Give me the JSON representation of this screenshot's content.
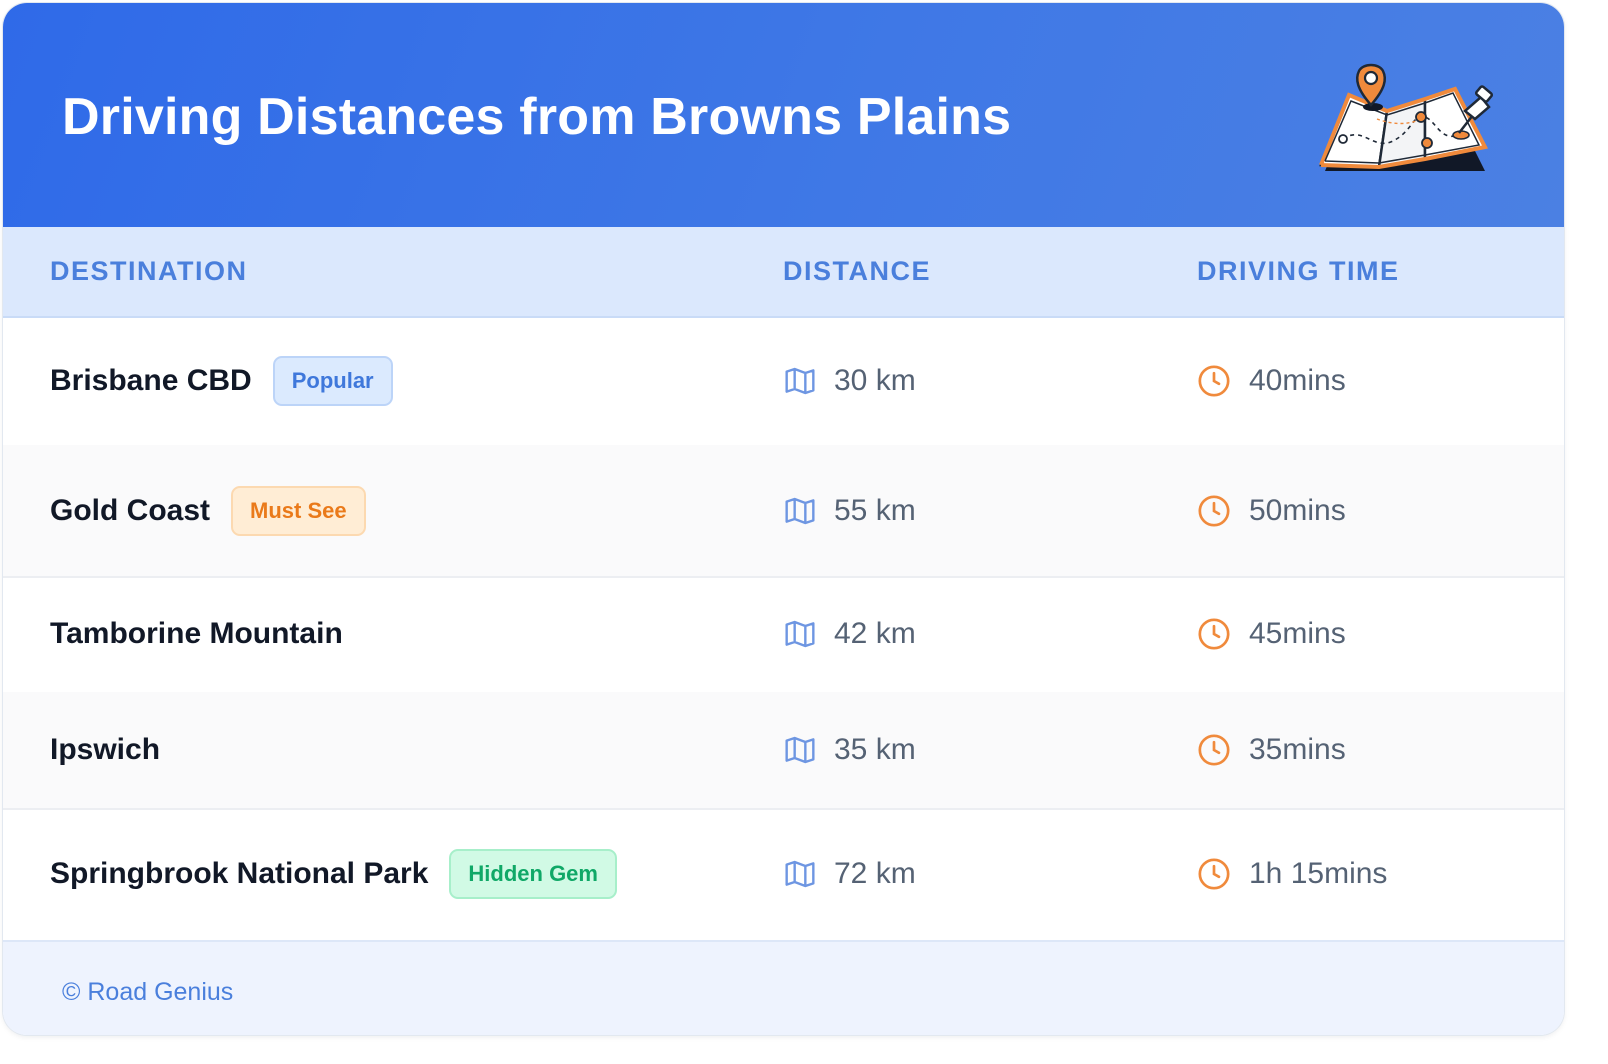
{
  "header": {
    "title": "Driving Distances from Browns Plains",
    "illustration": "map-with-pin-icon"
  },
  "table": {
    "columns": [
      "DESTINATION",
      "DISTANCE",
      "DRIVING TIME"
    ],
    "rows": [
      {
        "destination": "Brisbane CBD",
        "badge": "Popular",
        "badge_style": "blue",
        "distance": "30 km",
        "time": "40mins"
      },
      {
        "destination": "Gold Coast",
        "badge": "Must See",
        "badge_style": "orange",
        "distance": "55 km",
        "time": "50mins"
      },
      {
        "destination": "Tamborine Mountain",
        "badge": "",
        "badge_style": "",
        "distance": "42 km",
        "time": "45mins"
      },
      {
        "destination": "Ipswich",
        "badge": "",
        "badge_style": "",
        "distance": "35 km",
        "time": "35mins"
      },
      {
        "destination": "Springbrook National Park",
        "badge": "Hidden Gem",
        "badge_style": "green",
        "distance": "72 km",
        "time": "1h 15mins"
      }
    ]
  },
  "footer": {
    "text": "© Road Genius"
  },
  "icons": {
    "distance": "map-icon",
    "time": "clock-icon"
  },
  "colors": {
    "header_gradient_start": "#2f6ae8",
    "header_gradient_end": "#4b80e3",
    "accent_blue": "#4a7fdc",
    "accent_orange": "#f08a3c",
    "accent_green": "#10a867"
  }
}
